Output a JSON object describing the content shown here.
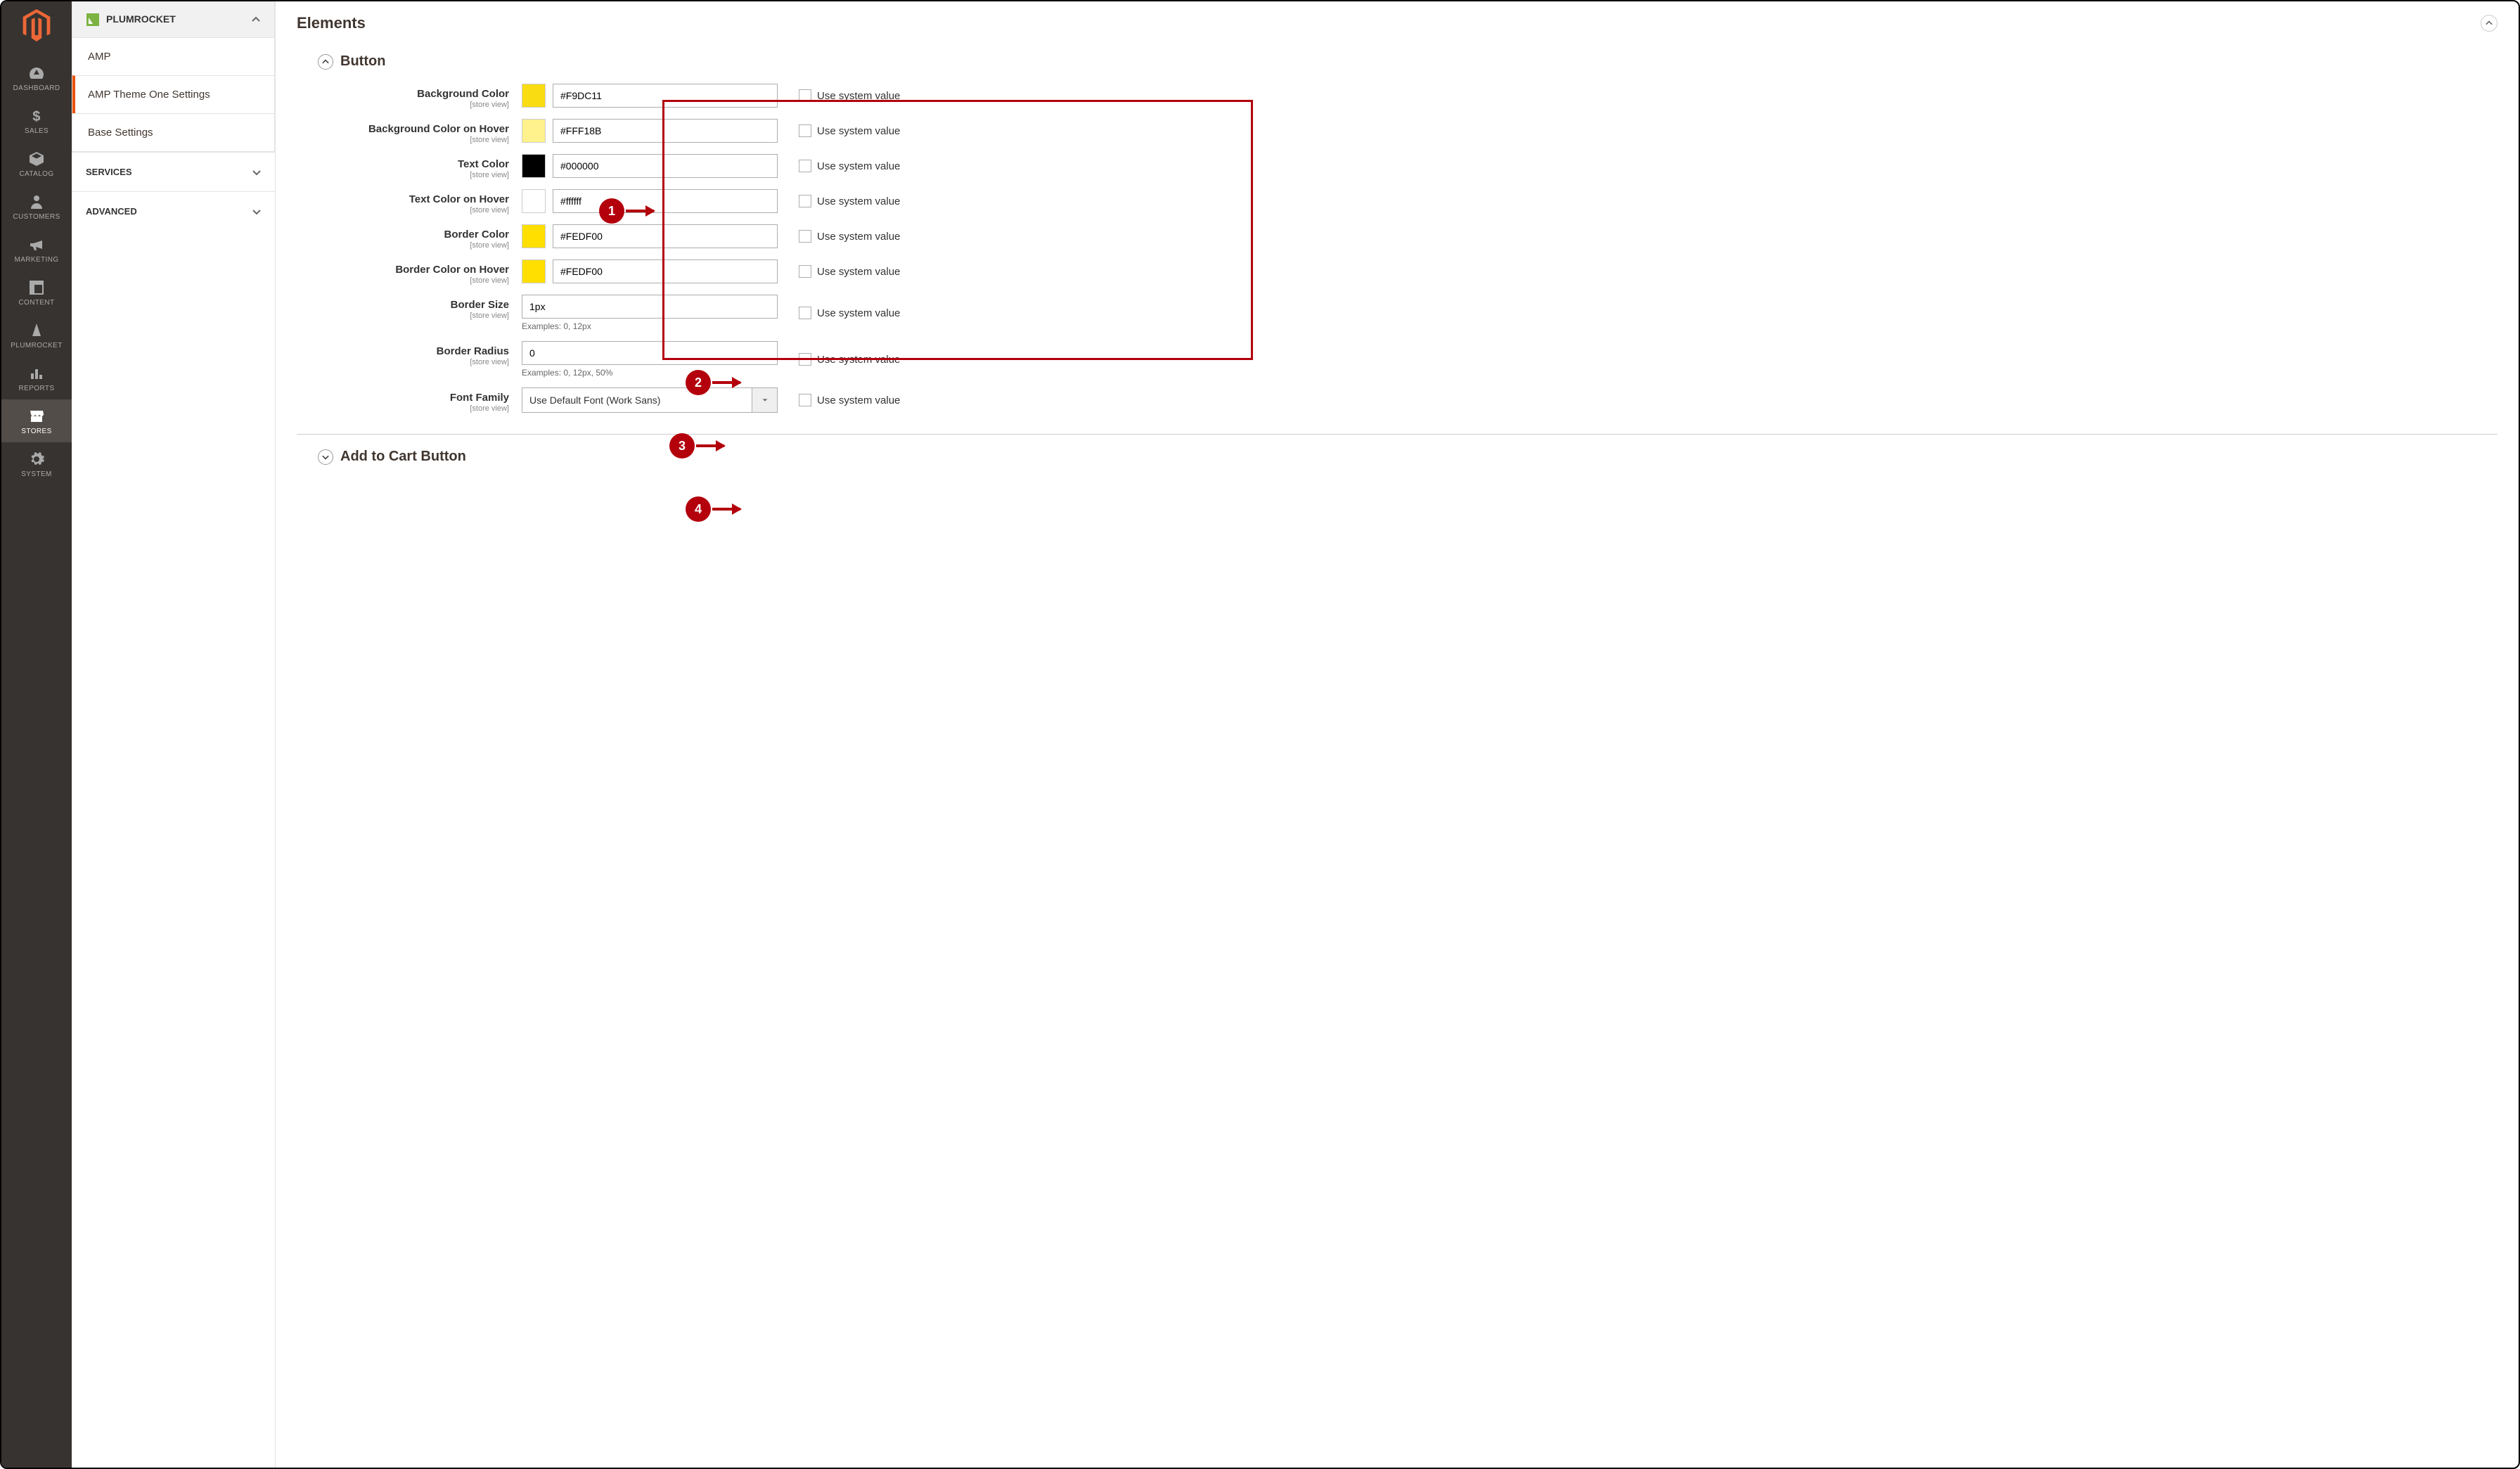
{
  "rail": [
    {
      "id": "dashboard",
      "label": "DASHBOARD"
    },
    {
      "id": "sales",
      "label": "SALES"
    },
    {
      "id": "catalog",
      "label": "CATALOG"
    },
    {
      "id": "customers",
      "label": "CUSTOMERS"
    },
    {
      "id": "marketing",
      "label": "MARKETING"
    },
    {
      "id": "content",
      "label": "CONTENT"
    },
    {
      "id": "plumrocket",
      "label": "PLUMROCKET"
    },
    {
      "id": "reports",
      "label": "REPORTS"
    },
    {
      "id": "stores",
      "label": "STORES",
      "active": true
    },
    {
      "id": "system",
      "label": "SYSTEM"
    }
  ],
  "side": {
    "group": "PLUMROCKET",
    "items": [
      "AMP",
      "AMP Theme One Settings",
      "Base Settings"
    ],
    "activeIndex": 1,
    "collapsed": [
      "SERVICES",
      "ADVANCED"
    ]
  },
  "section": {
    "title": "Elements"
  },
  "button_section": {
    "title": "Button",
    "store_view": "[store view]",
    "use_system": "Use system value",
    "fields": [
      {
        "label": "Background Color",
        "value": "#F9DC11",
        "swatch": "#F9DC11",
        "type": "color"
      },
      {
        "label": "Background Color on Hover",
        "value": "#FFF18B",
        "swatch": "#FFF18B",
        "type": "color"
      },
      {
        "label": "Text Color",
        "value": "#000000",
        "swatch": "#000000",
        "type": "color"
      },
      {
        "label": "Text Color on Hover",
        "value": "#ffffff",
        "swatch": "#ffffff",
        "type": "color"
      },
      {
        "label": "Border Color",
        "value": "#FEDF00",
        "swatch": "#FEDF00",
        "type": "color"
      },
      {
        "label": "Border Color on Hover",
        "value": "#FEDF00",
        "swatch": "#FEDF00",
        "type": "color"
      },
      {
        "label": "Border Size",
        "value": "1px",
        "type": "text",
        "hint": "Examples: 0, 12px"
      },
      {
        "label": "Border Radius",
        "value": "0",
        "type": "text",
        "hint": "Examples: 0, 12px, 50%"
      },
      {
        "label": "Font Family",
        "value": "Use Default Font (Work Sans)",
        "type": "select"
      }
    ]
  },
  "next_section": {
    "title": "Add to Cart Button"
  },
  "callouts": [
    "1",
    "2",
    "3",
    "4"
  ]
}
